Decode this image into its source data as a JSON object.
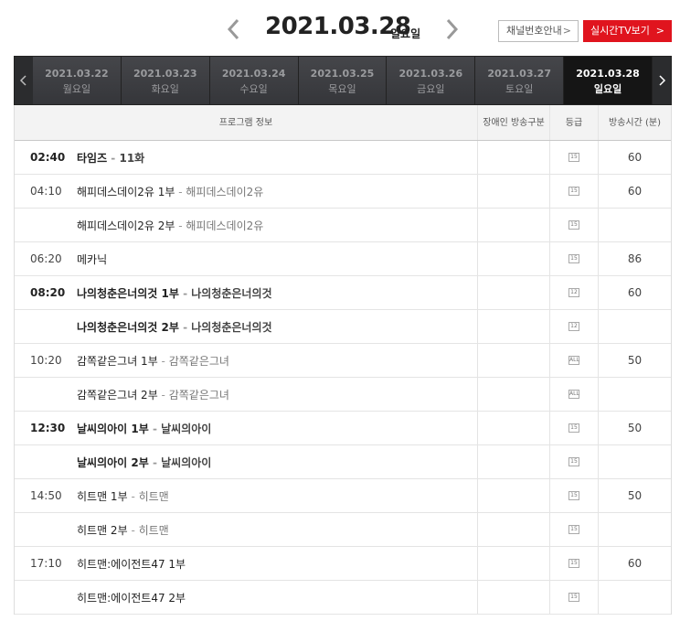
{
  "header": {
    "date": "2021.03.28",
    "day": "일요일",
    "prev_icon": "chevron-left-icon",
    "next_icon": "chevron-right-icon",
    "channel_guide_label": "채널번호안내",
    "live_tv_label": "실시간TV보기",
    "accent_color": "#e0141e"
  },
  "tabs": [
    {
      "date": "2021.03.22",
      "day": "월요일"
    },
    {
      "date": "2021.03.23",
      "day": "화요일"
    },
    {
      "date": "2021.03.24",
      "day": "수요일"
    },
    {
      "date": "2021.03.25",
      "day": "목요일"
    },
    {
      "date": "2021.03.26",
      "day": "금요일"
    },
    {
      "date": "2021.03.27",
      "day": "토요일"
    },
    {
      "date": "2021.03.28",
      "day": "일요일"
    }
  ],
  "table": {
    "headers": {
      "program": "프로그램 정보",
      "disability": "장애인 방송구분",
      "grade": "등급",
      "runtime": "방송시간 (분)"
    },
    "rows": [
      {
        "time": "02:40",
        "title": "타임즈",
        "subtitle": "11화",
        "grade": "15",
        "runtime": "60"
      },
      {
        "time": "04:10",
        "title": "해피데스데이2유 1부",
        "subtitle": "해피데스데이2유",
        "grade": "15",
        "runtime": "60"
      },
      {
        "time": "",
        "title": "해피데스데이2유 2부",
        "subtitle": "해피데스데이2유",
        "grade": "15",
        "runtime": ""
      },
      {
        "time": "06:20",
        "title": "메카닉",
        "subtitle": "",
        "grade": "15",
        "runtime": "86"
      },
      {
        "time": "08:20",
        "title": "나의청춘은너의것 1부",
        "subtitle": "나의청춘은너의것",
        "grade": "12",
        "runtime": "60"
      },
      {
        "time": "",
        "title": "나의청춘은너의것 2부",
        "subtitle": "나의청춘은너의것",
        "grade": "12",
        "runtime": ""
      },
      {
        "time": "10:20",
        "title": "감쪽같은그녀 1부",
        "subtitle": "감쪽같은그녀",
        "grade": "ALL",
        "runtime": "50"
      },
      {
        "time": "",
        "title": "감쪽같은그녀 2부",
        "subtitle": "감쪽같은그녀",
        "grade": "ALL",
        "runtime": ""
      },
      {
        "time": "12:30",
        "title": "날씨의아이 1부",
        "subtitle": "날씨의아이",
        "grade": "15",
        "runtime": "50"
      },
      {
        "time": "",
        "title": "날씨의아이 2부",
        "subtitle": "날씨의아이",
        "grade": "15",
        "runtime": ""
      },
      {
        "time": "14:50",
        "title": "히트맨 1부",
        "subtitle": "히트맨",
        "grade": "15",
        "runtime": "50"
      },
      {
        "time": "",
        "title": "히트맨 2부",
        "subtitle": "히트맨",
        "grade": "15",
        "runtime": ""
      },
      {
        "time": "17:10",
        "title": "히트맨:에이전트47 1부",
        "subtitle": "",
        "grade": "15",
        "runtime": "60"
      },
      {
        "time": "",
        "title": "히트맨:에이전트47 2부",
        "subtitle": "",
        "grade": "15",
        "runtime": ""
      }
    ]
  }
}
